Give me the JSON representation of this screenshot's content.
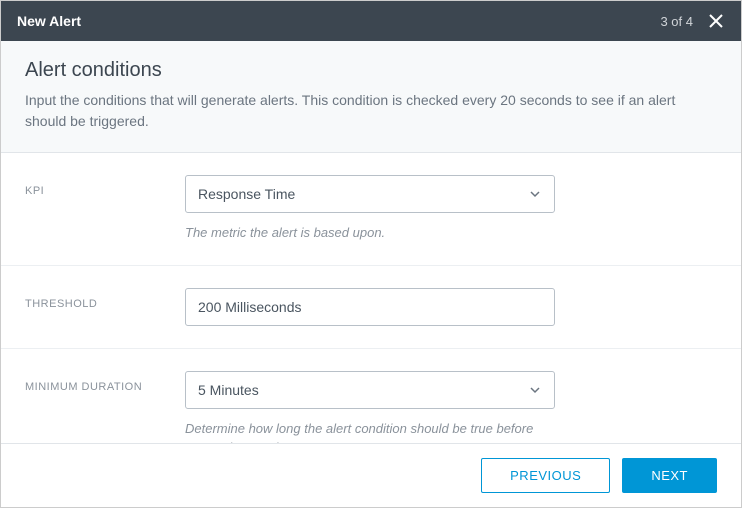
{
  "header": {
    "title": "New Alert",
    "step": "3 of 4"
  },
  "section": {
    "title": "Alert conditions",
    "description": "Input the conditions that will generate alerts. This condition is checked every 20 seconds to see if an alert should be triggered."
  },
  "fields": {
    "kpi": {
      "label": "KPI",
      "value": "Response Time",
      "help": "The metric the alert is based upon."
    },
    "threshold": {
      "label": "THRESHOLD",
      "value": "200 Milliseconds"
    },
    "min_duration": {
      "label": "MINIMUM DURATION",
      "value": "5 Minutes",
      "help": "Determine how long the alert condition should be true before generating an alert."
    }
  },
  "footer": {
    "previous": "PREVIOUS",
    "next": "NEXT"
  }
}
